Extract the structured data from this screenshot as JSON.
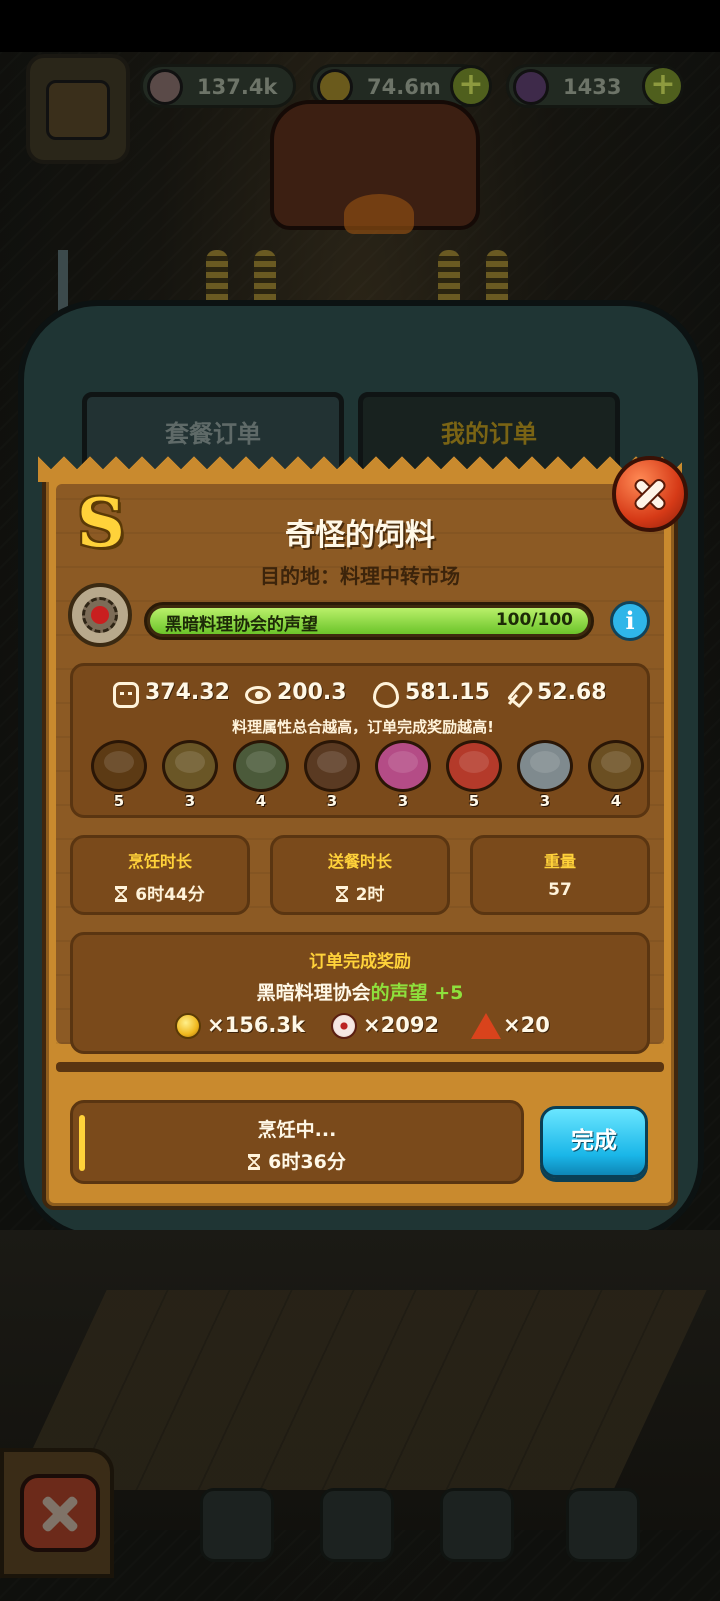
{
  "hud": {
    "eyeballs": "137.4k",
    "coins": "74.6m",
    "potions": "1433",
    "plus_symbol": "+"
  },
  "tabs": {
    "combo_orders": "套餐订单",
    "my_orders": "我的订单"
  },
  "order": {
    "rank": "S",
    "title": "奇怪的饲料",
    "destination": "目的地：料理中转市场",
    "reputation": {
      "label": "黑暗料理协会的声望",
      "value_text": "100/100",
      "fraction": 1.0
    },
    "info_symbol": "i"
  },
  "stats": {
    "texture": "374.32",
    "appearance": "200.3",
    "heat": "581.15",
    "technique": "52.68",
    "hint": "料理属性总合越高，订单完成奖励越高!"
  },
  "dishes": [
    {
      "qty": "5",
      "color": "#5c3a14"
    },
    {
      "qty": "3",
      "color": "#6a5626"
    },
    {
      "qty": "4",
      "color": "#4b5a3a"
    },
    {
      "qty": "3",
      "color": "#5a3a22"
    },
    {
      "qty": "3",
      "color": "#b44c86"
    },
    {
      "qty": "5",
      "color": "#b43a2a"
    },
    {
      "qty": "3",
      "color": "#7f8a8e"
    },
    {
      "qty": "4",
      "color": "#6b4f22"
    }
  ],
  "info_cards": {
    "cook_time_label": "烹饪时长",
    "cook_time_value": "6时44分",
    "delivery_time_label": "送餐时长",
    "delivery_time_value": "2时",
    "weight_label": "重量",
    "weight_value": "57"
  },
  "rewards": {
    "title": "订单完成奖励",
    "rep_guild": "黑暗料理协会",
    "rep_suffix": "的声望",
    "rep_amount": "+5",
    "coins": "×156.3k",
    "eyeballs": "×2092",
    "shards": "×20"
  },
  "cooking": {
    "state": "烹饪中...",
    "remaining": "6时36分",
    "complete_label": "完成"
  },
  "colors": {
    "panel": "#c98a2e",
    "accent_gold": "#ffd23a",
    "progress_green": "#6cc42a",
    "complete_blue": "#1ab6e8",
    "close_red": "#d63a17"
  }
}
